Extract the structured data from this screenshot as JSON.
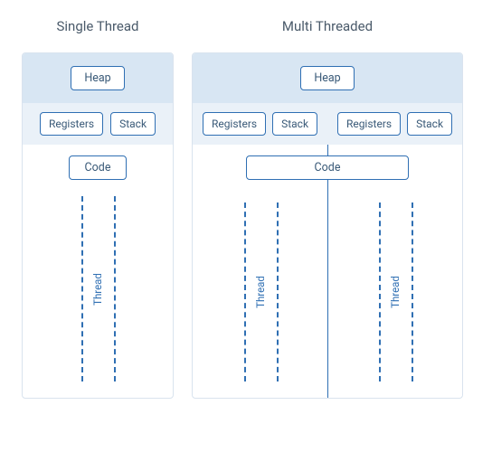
{
  "single": {
    "title": "Single Thread",
    "heap": "Heap",
    "registers": "Registers",
    "stack": "Stack",
    "code": "Code",
    "thread_label": "Thread"
  },
  "multi": {
    "title": "Multi Threaded",
    "heap": "Heap",
    "left": {
      "registers": "Registers",
      "stack": "Stack",
      "thread_label": "Thread"
    },
    "right": {
      "registers": "Registers",
      "stack": "Stack",
      "thread_label": "Thread"
    },
    "code": "Code"
  }
}
